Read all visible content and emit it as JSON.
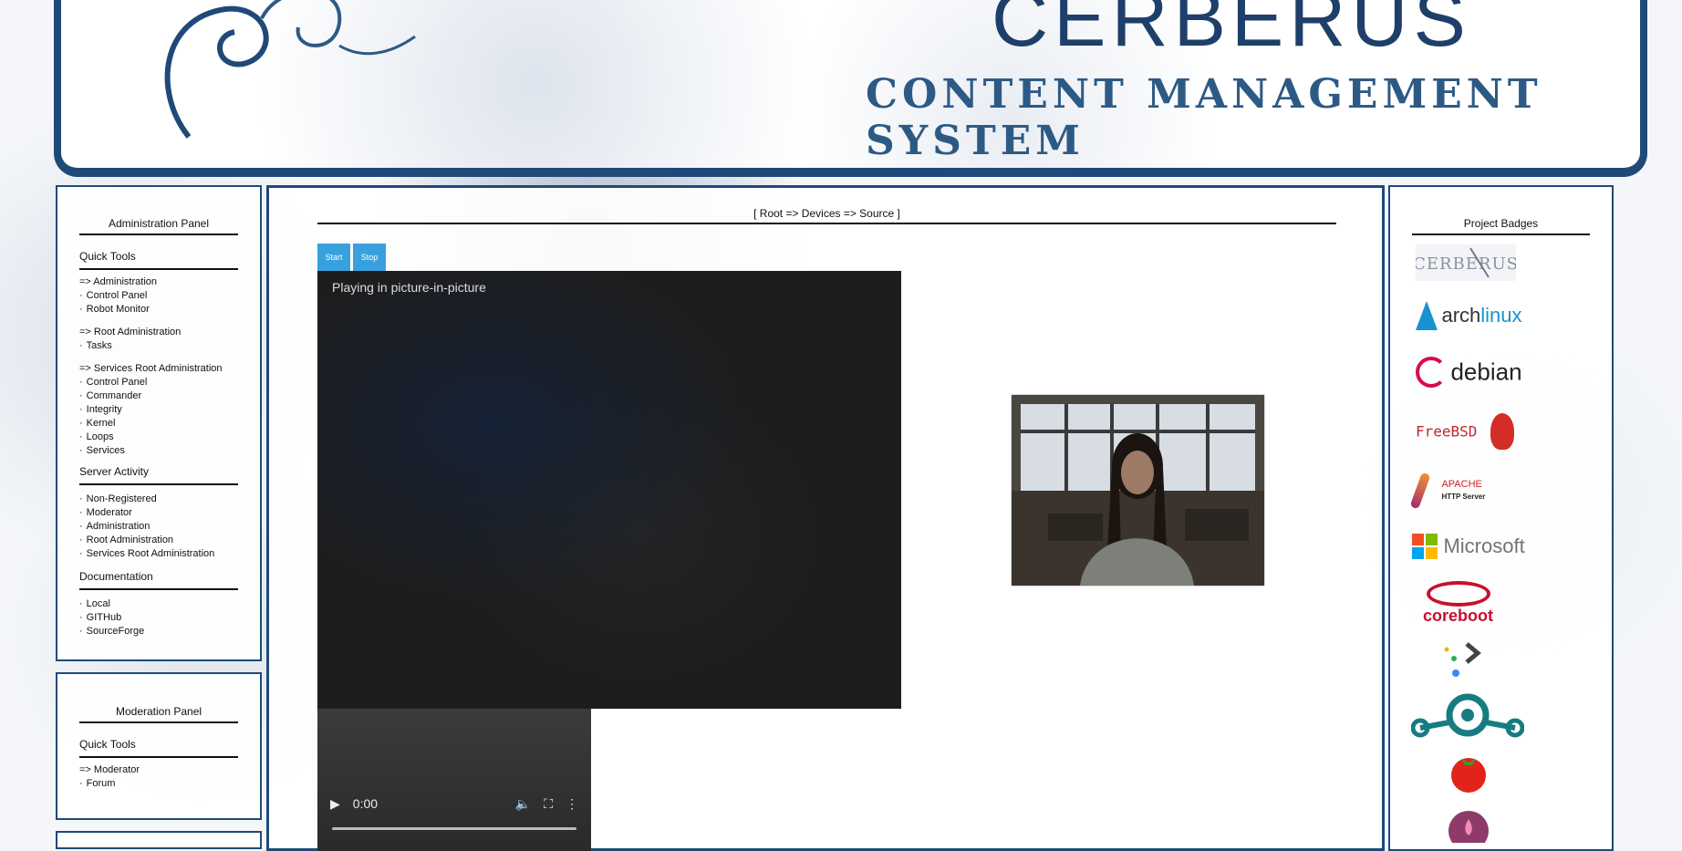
{
  "banner": {
    "title": "CERBERUS",
    "subtitle": "CONTENT MANAGEMENT SYSTEM"
  },
  "admin_panel": {
    "title": "Administration Panel",
    "quick_tools": "Quick Tools",
    "admin_head": "=> Administration",
    "admin_items": [
      "Control Panel",
      "Robot Monitor"
    ],
    "root_head": "=> Root Administration",
    "root_items": [
      "Tasks"
    ],
    "services_head": "=> Services Root Administration",
    "services_items": [
      "Control Panel",
      "Commander",
      "Integrity",
      "Kernel",
      "Loops",
      "Services"
    ],
    "server_activity": "Server Activity",
    "server_items": [
      "Non-Registered",
      "Moderator",
      "Administration",
      "Root Administration",
      "Services Root Administration"
    ],
    "documentation": "Documentation",
    "doc_items": [
      "Local",
      "GITHub",
      "SourceForge"
    ]
  },
  "moderation_panel": {
    "title": "Moderation Panel",
    "quick_tools": "Quick Tools",
    "mod_head": "=> Moderator",
    "mod_items": [
      "Forum"
    ]
  },
  "main": {
    "breadcrumb": "[ Root => Devices => Source ]",
    "start_label": "Start",
    "stop_label": "Stop",
    "pip_text": "Playing in picture-in-picture",
    "time": "0:00"
  },
  "badges": {
    "title": "Project Badges",
    "cerberus": "CERBERUS",
    "arch_a": "arch",
    "arch_b": "linux",
    "debian": "debian",
    "freebsd": "FreeBSD",
    "apache": "APACHE",
    "apache_sub": "HTTP Server",
    "microsoft": "Microsoft",
    "coreboot": "coreboot"
  }
}
